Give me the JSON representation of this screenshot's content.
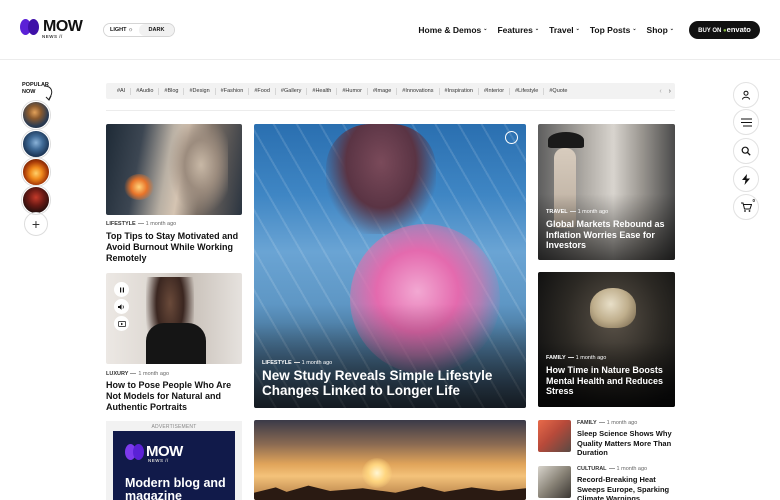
{
  "header": {
    "logo_text": "MOW",
    "logo_sub": "NEWS //",
    "theme": {
      "light": "LIGHT",
      "dark": "DARK"
    },
    "nav": [
      {
        "label": "Home & Demos"
      },
      {
        "label": "Features"
      },
      {
        "label": "Travel"
      },
      {
        "label": "Top Posts"
      },
      {
        "label": "Shop"
      }
    ],
    "buy_button": {
      "prefix": "BUY ON",
      "brand": "envato"
    }
  },
  "left_rail": {
    "popular_label_1": "POPULAR",
    "popular_label_2": "NOW",
    "plus": "+"
  },
  "right_rail": {
    "cart_count": "0"
  },
  "tags": [
    "#AI",
    "#Audio",
    "#Blog",
    "#Design",
    "#Fashion",
    "#Food",
    "#Gallery",
    "#Health",
    "#Humor",
    "#Image",
    "#Innovations",
    "#Inspiration",
    "#Interior",
    "#Lifestyle",
    "#Quote"
  ],
  "tags_nav": {
    "prev": "‹",
    "next": "›"
  },
  "posts": {
    "post1": {
      "category": "LIFESTYLE",
      "time": "1 month ago",
      "title": "Top Tips to Stay Motivated and Avoid Burnout While Working Remotely"
    },
    "post2": {
      "category": "LUXURY",
      "time": "1 month ago",
      "title": "How to Pose People Who Are Not Models for Natural and Authentic Portraits"
    },
    "hero": {
      "category": "LIFESTYLE",
      "time": "1 month ago",
      "title": "New Study Reveals Simple Lifestyle Changes Linked to Longer Life"
    },
    "right1": {
      "category": "TRAVEL",
      "time": "1 month ago",
      "title": "Global Markets Rebound as Inflation Worries Ease for Investors"
    },
    "right2": {
      "category": "FAMILY",
      "time": "1 month ago",
      "title": "How Time in Nature Boosts Mental Health and Reduces Stress"
    },
    "list1": {
      "category": "FAMILY",
      "time": "1 month ago",
      "title": "Sleep Science Shows Why Quality Matters More Than Duration"
    },
    "list2": {
      "category": "CULTURAL",
      "time": "1 month ago",
      "title": "Record-Breaking Heat Sweeps Europe, Sparking Climate Warnings"
    }
  },
  "ad": {
    "label": "ADVERTISEMENT",
    "logo_text": "MOW",
    "logo_sub": "NEWS //",
    "headline": "Modern blog and magazine"
  },
  "colors": {
    "brand": "#5b21d6",
    "dark": "#111111"
  }
}
